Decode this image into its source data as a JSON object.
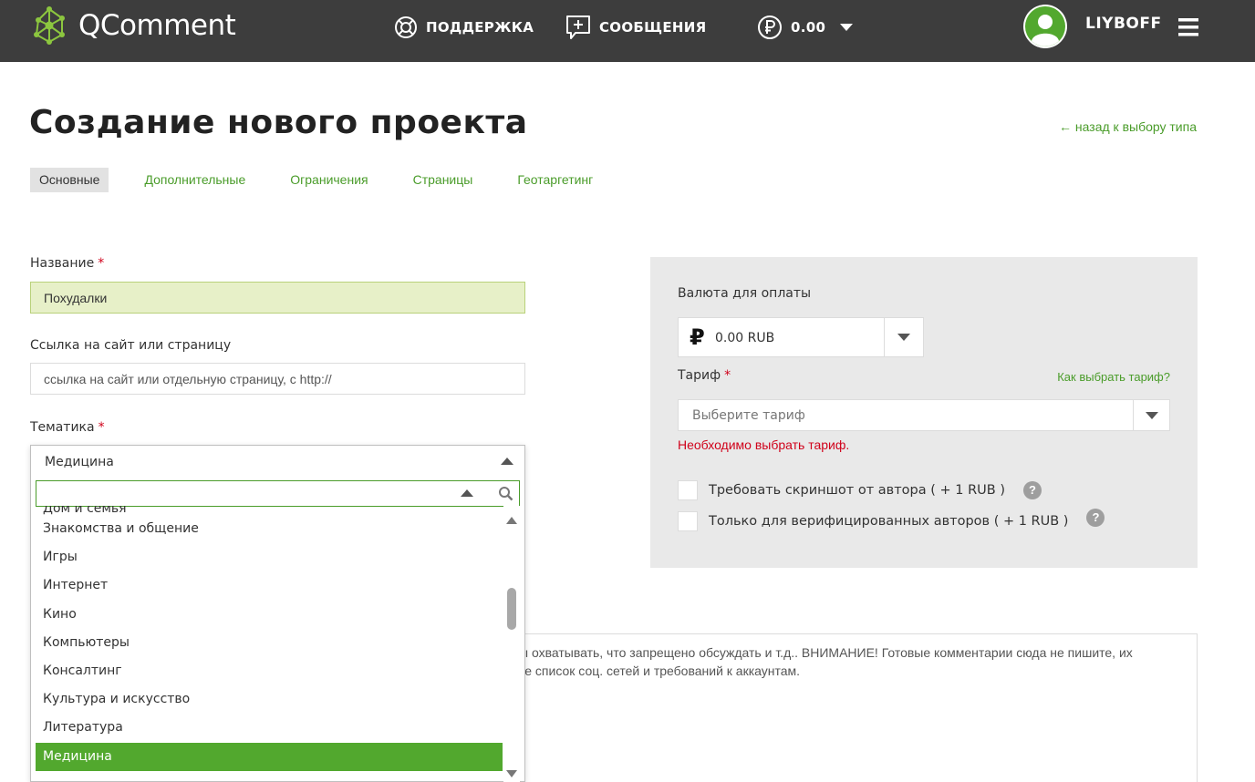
{
  "header": {
    "logo_text": "QComment",
    "support_label": "ПОДДЕРЖКА",
    "messages_label": "СООБЩЕНИЯ",
    "balance": "0.00",
    "username": "LIYBOFF"
  },
  "page": {
    "title": "Создание нового проекта",
    "back_link": "← назад к выбору типа"
  },
  "tabs": [
    {
      "label": "Основные",
      "active": true
    },
    {
      "label": "Дополнительные"
    },
    {
      "label": "Ограничения"
    },
    {
      "label": "Страницы"
    },
    {
      "label": "Геотаргетинг"
    }
  ],
  "form": {
    "name_label": "Название",
    "name_value": "Похудалки",
    "link_label": "Ссылка на сайт или страницу",
    "link_placeholder": "ссылка на сайт или отдельную страницу, с http://",
    "topic_label": "Тематика",
    "topic_selected": "Медицина",
    "required_mark": "*",
    "topic_options": [
      "Дом и семья",
      "Знакомства и общение",
      "Игры",
      "Интернет",
      "Кино",
      "Компьютеры",
      "Консалтинг",
      "Культура и искусство",
      "Литература",
      "Медицина"
    ],
    "description_line1": "ы охватывать, что запрещено обсуждать и т.д.. ВНИМАНИЕ! Готовые комментарии сюда не пишите, их",
    "description_line2": "те список соц. сетей и требований к аккаунтам."
  },
  "payment": {
    "currency_label": "Валюта для оплаты",
    "currency_symbol": "₽",
    "currency_value": "0.00 RUB",
    "tariff_label": "Тариф",
    "tariff_help_link": "Как выбрать тариф?",
    "tariff_placeholder": "Выберите тариф",
    "tariff_error": "Необходимо выбрать тариф.",
    "options": [
      {
        "label": "Требовать скриншот от автора ( + 1 RUB )",
        "checked": false
      },
      {
        "label": "Только для верифицированных авторов ( + 1 RUB )",
        "checked": false
      }
    ],
    "help_glyph": "?"
  },
  "colors": {
    "header_bg": "#3d3d3d",
    "accent_green": "#4a9c2a",
    "selected_option": "#52a82e",
    "error_red": "#d0021b",
    "filled_input": "#e7f0c8",
    "panel_bg": "#e9e9e9"
  }
}
